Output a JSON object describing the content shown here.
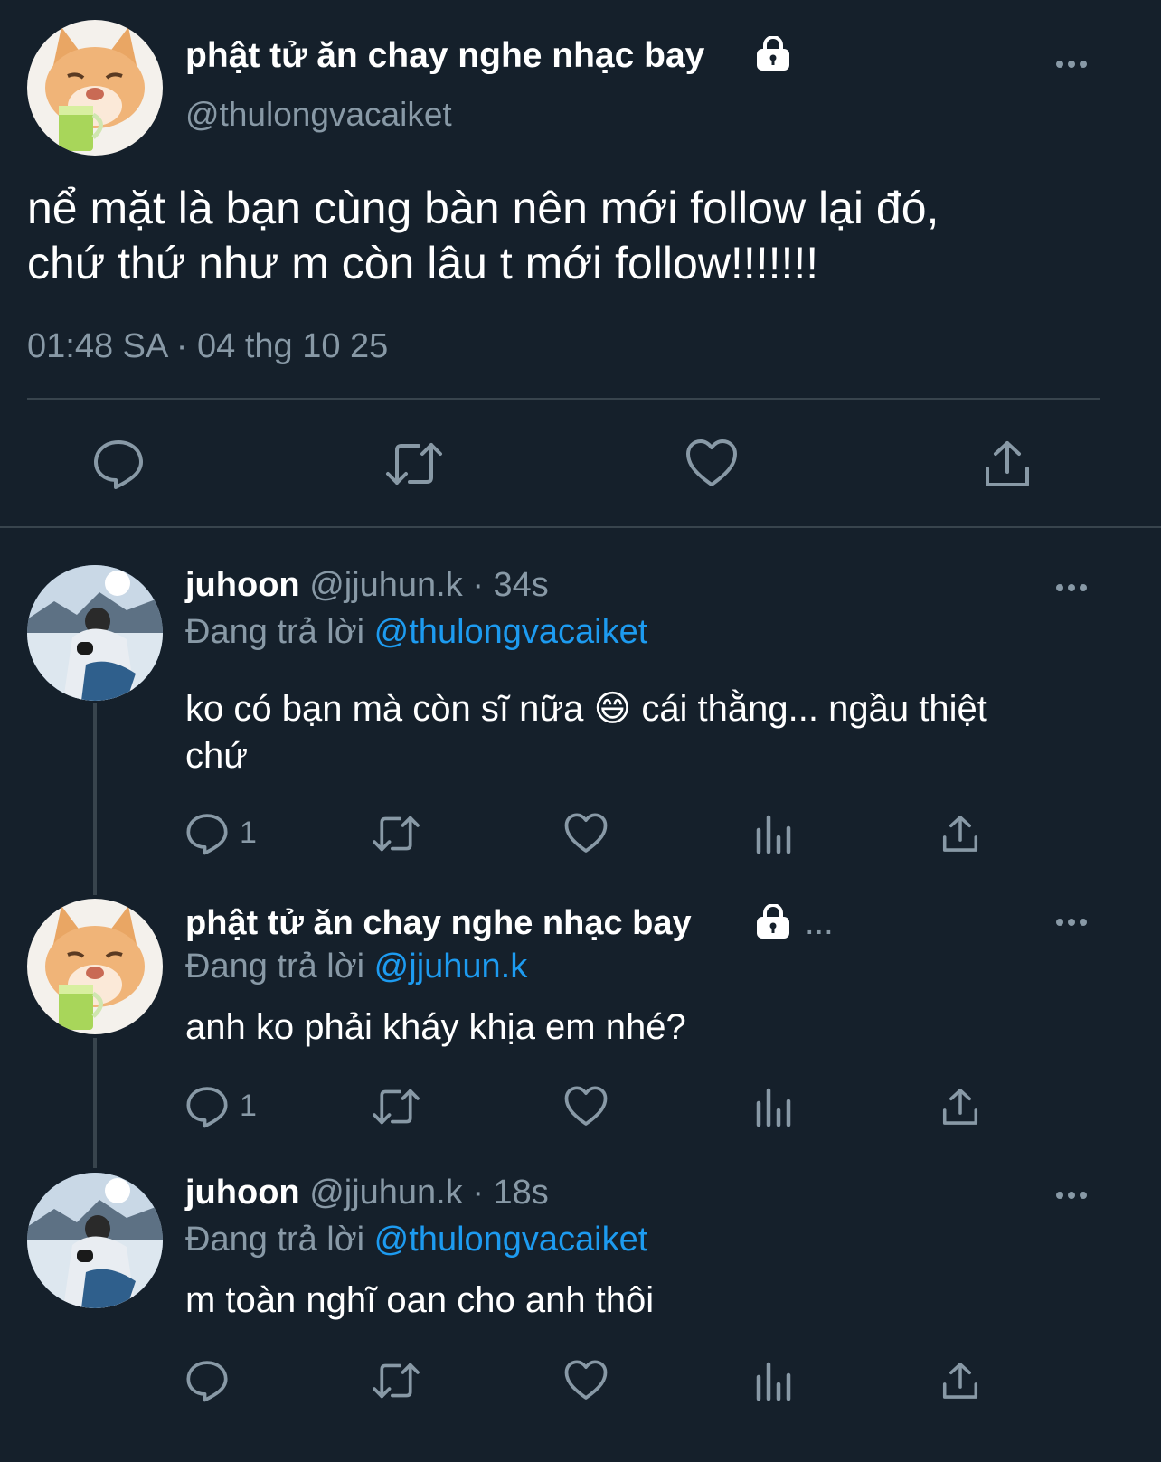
{
  "main_tweet": {
    "display_name": "phật tử ăn chay nghe nhạc bay",
    "handle": "@thulongvacaiket",
    "text_line1": "nể mặt là bạn cùng bàn nên mới follow lại đó,",
    "text_line2": "chứ thứ như m còn lâu t mới follow!!!!!!!",
    "timestamp": "01:48 SA · 04 thg 10 25",
    "icons": [
      "reply-icon",
      "retweet-icon",
      "like-icon",
      "share-icon"
    ]
  },
  "replies": [
    {
      "display_name": "juhoon",
      "handle": "@jjuhun.k",
      "time": "· 34s",
      "replying_prefix": "Đang trả lời",
      "replying_to": "@thulongvacaiket",
      "text_line1": "ko có bạn mà còn sĩ nữa",
      "emoji": "😄",
      "text_line1b": "cái thằng... ngầu thiệt",
      "text_line2": "chứ",
      "reply_count": "1"
    },
    {
      "display_name": "phật tử ăn chay nghe nhạc bay",
      "truncation": "...",
      "replying_prefix": "Đang trả lời",
      "replying_to": "@jjuhun.k",
      "text_line1": "anh ko phải kháy khịa em nhé?",
      "reply_count": "1"
    },
    {
      "display_name": "juhoon",
      "handle": "@jjuhun.k",
      "time": "· 18s",
      "replying_prefix": "Đang trả lời",
      "replying_to": "@thulongvacaiket",
      "text_line1": "m toàn nghĩ oan cho anh thôi",
      "reply_count": ""
    }
  ],
  "colors": {
    "background": "#15202b",
    "muted": "#8899a6",
    "link": "#1d9bf0",
    "divider": "#38444d"
  }
}
